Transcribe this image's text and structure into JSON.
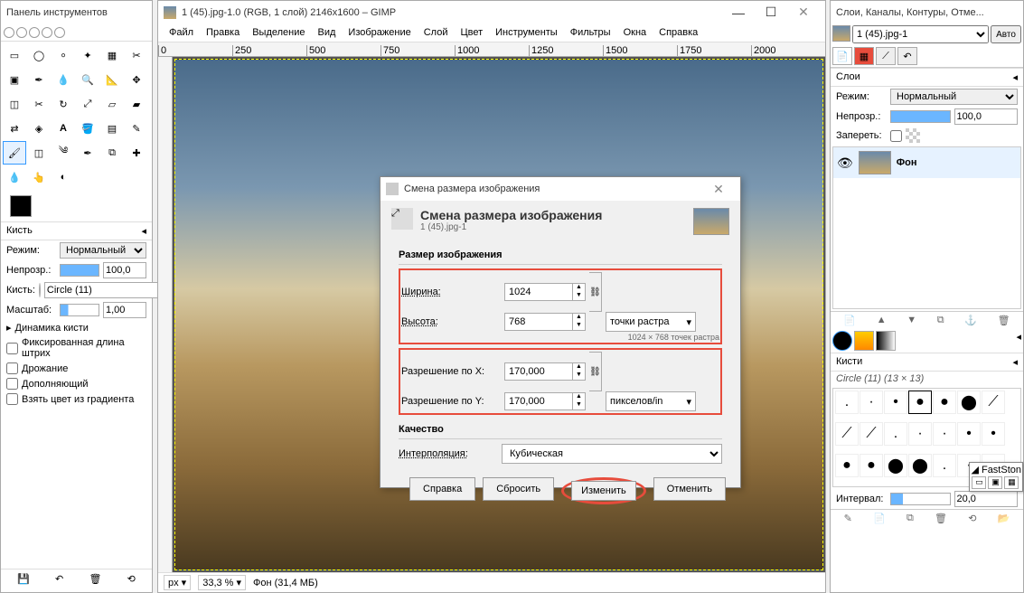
{
  "toolbox": {
    "title": "Панель инструментов",
    "brush_section": "Кисть",
    "mode_label": "Режим:",
    "mode_value": "Нормальный",
    "opacity_label": "Непрозр.:",
    "opacity_value": "100,0",
    "brush_label": "Кисть:",
    "brush_value": "Circle (11)",
    "scale_label": "Масштаб:",
    "scale_value": "1,00",
    "dynamics": "Динамика кисти",
    "fixed_len": "Фиксированная длина штрих",
    "jitter": "Дрожание",
    "additive": "Дополняющий",
    "grad_color": "Взять цвет из градиента"
  },
  "main": {
    "title": "1 (45).jpg-1.0 (RGB, 1 слой) 2146x1600 – GIMP",
    "menu": [
      "Файл",
      "Правка",
      "Выделение",
      "Вид",
      "Изображение",
      "Слой",
      "Цвет",
      "Инструменты",
      "Фильтры",
      "Окна",
      "Справка"
    ],
    "ruler_ticks": [
      "0",
      "250",
      "500",
      "750",
      "1000",
      "1250",
      "1500",
      "1750",
      "2000"
    ],
    "status_units": "px",
    "status_zoom": "33,3 %",
    "status_info": "Фон (31,4 МБ)"
  },
  "dialog": {
    "title": "Смена размера изображения",
    "heading": "Смена размера изображения",
    "sub": "1 (45).jpg-1",
    "size_section": "Размер изображения",
    "width_label": "Ширина:",
    "width_value": "1024",
    "height_label": "Высота:",
    "height_value": "768",
    "hint": "1024 × 768 точек растра",
    "units_label": "точки растра",
    "resx_label": "Разрешение по X:",
    "resx_value": "170,000",
    "resy_label": "Разрешение по Y:",
    "resy_value": "170,000",
    "res_units": "пикселов/in",
    "quality_section": "Качество",
    "interp_label": "Интерполяция:",
    "interp_value": "Кубическая",
    "btn_help": "Справка",
    "btn_reset": "Сбросить",
    "btn_ok": "Изменить",
    "btn_cancel": "Отменить"
  },
  "right": {
    "title": "Слои, Каналы, Контуры, Отме...",
    "image_sel": "1 (45).jpg-1",
    "auto": "Авто",
    "layers_title": "Слои",
    "mode_label": "Режим:",
    "mode_value": "Нормальный",
    "opacity_label": "Непрозр.:",
    "opacity_value": "100,0",
    "lock_label": "Запереть:",
    "layer_name": "Фон",
    "brushes_title": "Кисти",
    "brush_info": "Circle (11) (13 × 13)",
    "interval_label": "Интервал:",
    "interval_value": "20,0",
    "popup_title": "FastSton"
  }
}
